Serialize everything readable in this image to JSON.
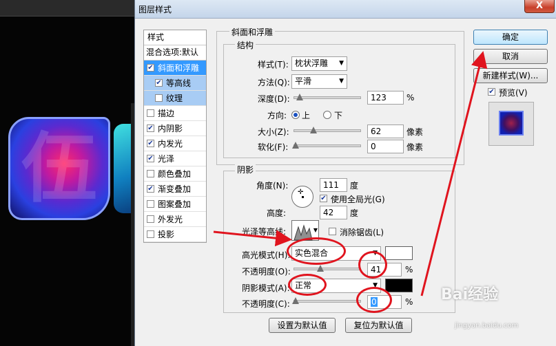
{
  "dialog": {
    "title": "图层样式",
    "close_label": "X"
  },
  "background": {
    "char1": "伍"
  },
  "styles_list": {
    "header": "样式",
    "blend": "混合选项:默认",
    "items": [
      {
        "label": "斜面和浮雕",
        "checked": true
      },
      {
        "label": "等高线",
        "checked": true
      },
      {
        "label": "纹理",
        "checked": false
      },
      {
        "label": "描边",
        "checked": false
      },
      {
        "label": "内阴影",
        "checked": true
      },
      {
        "label": "内发光",
        "checked": true
      },
      {
        "label": "光泽",
        "checked": true
      },
      {
        "label": "颜色叠加",
        "checked": false
      },
      {
        "label": "渐变叠加",
        "checked": true
      },
      {
        "label": "图案叠加",
        "checked": false
      },
      {
        "label": "外发光",
        "checked": false
      },
      {
        "label": "投影",
        "checked": false
      }
    ]
  },
  "bevel": {
    "group_title": "斜面和浮雕",
    "structure_title": "结构",
    "style_label": "样式(T):",
    "style_value": "枕状浮雕",
    "method_label": "方法(Q):",
    "method_value": "平滑",
    "depth_label": "深度(D):",
    "depth_value": "123",
    "depth_unit": "%",
    "direction_label": "方向:",
    "dir_up": "上",
    "dir_down": "下",
    "size_label": "大小(Z):",
    "size_value": "62",
    "size_unit": "像素",
    "soften_label": "软化(F):",
    "soften_value": "0",
    "soften_unit": "像素"
  },
  "shading": {
    "title": "阴影",
    "angle_label": "角度(N):",
    "angle_value": "111",
    "angle_unit": "度",
    "global_light_label": "使用全局光(G)",
    "altitude_label": "高度:",
    "altitude_value": "42",
    "altitude_unit": "度",
    "gloss_contour_label": "光泽等高线:",
    "antialias_label": "消除锯齿(L)",
    "highlight_mode_label": "高光模式(H):",
    "highlight_mode_value": "实色混合",
    "highlight_opacity_label": "不透明度(O):",
    "highlight_opacity_value": "41",
    "highlight_opacity_unit": "%",
    "shadow_mode_label": "阴影模式(A):",
    "shadow_mode_value": "正常",
    "shadow_opacity_label": "不透明度(C):",
    "shadow_opacity_value": "0",
    "shadow_opacity_unit": "%",
    "highlight_color": "#ffffff",
    "shadow_color": "#000000"
  },
  "footer": {
    "set_default": "设置为默认值",
    "reset_default": "复位为默认值"
  },
  "right_panel": {
    "ok": "确定",
    "cancel": "取消",
    "new_style": "新建样式(W)...",
    "preview": "预览(V)"
  },
  "watermark": {
    "brand": "Bai经验",
    "url": "jingyan.baidu.com"
  }
}
